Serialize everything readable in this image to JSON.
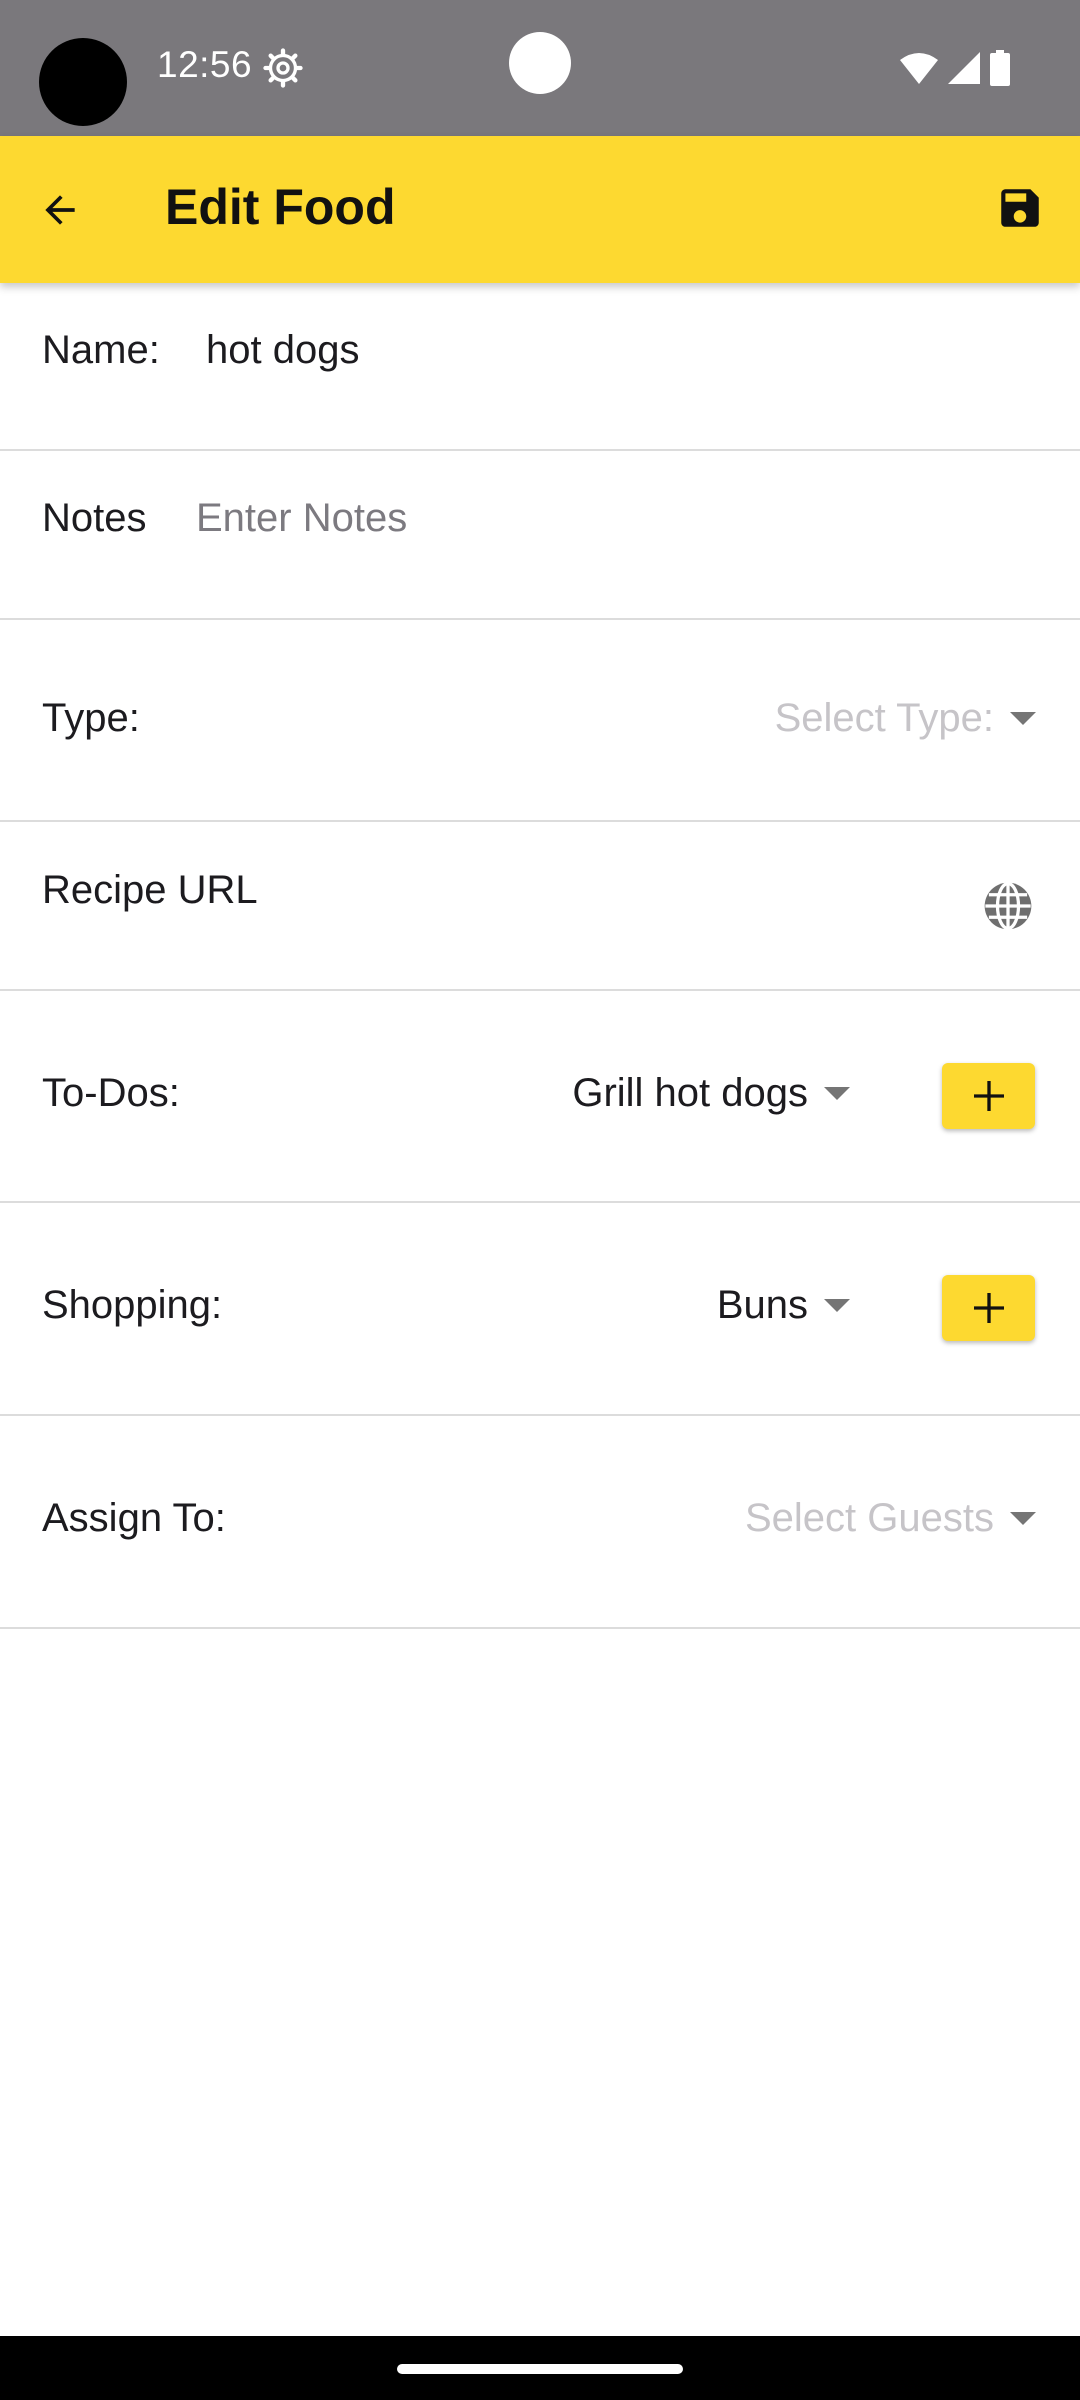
{
  "status_bar": {
    "time": "12:56",
    "icons": [
      "camera-cutout",
      "settings-gear-icon",
      "wifi-icon",
      "cell-signal-icon",
      "battery-icon"
    ]
  },
  "app_bar": {
    "title": "Edit Food",
    "back_icon": "arrow-back-icon",
    "save_icon": "save-floppy-icon",
    "background_color": "#fdd930"
  },
  "form": {
    "name": {
      "label": "Name:",
      "value": "hot dogs"
    },
    "notes": {
      "label": "Notes",
      "placeholder": "Enter Notes"
    },
    "type": {
      "label": "Type:",
      "placeholder": "Select Type:"
    },
    "recipe": {
      "label": "Recipe URL",
      "icon": "globe-icon"
    },
    "todos": {
      "label": "To-Dos:",
      "selected": "Grill hot dogs",
      "add_icon": "plus-icon"
    },
    "shopping": {
      "label": "Shopping:",
      "selected": "Buns",
      "add_icon": "plus-icon"
    },
    "assign": {
      "label": "Assign To:",
      "placeholder": "Select Guests"
    }
  }
}
